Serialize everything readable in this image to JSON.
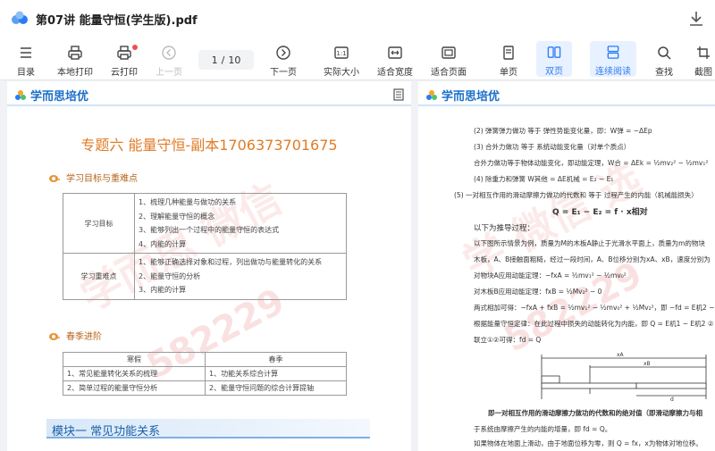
{
  "window": {
    "title": "第07讲 能量守恒(学生版).pdf"
  },
  "toolbar": {
    "items": [
      {
        "label": "目录",
        "icon": "list-icon"
      },
      {
        "label": "本地打印",
        "icon": "printer-icon"
      },
      {
        "label": "云打印",
        "icon": "cloud-printer-icon"
      },
      {
        "label": "上一页",
        "icon": "prev-page-icon"
      },
      {
        "label": "下一页",
        "icon": "next-page-icon"
      },
      {
        "label": "实际大小",
        "icon": "actual-size-icon"
      },
      {
        "label": "适合宽度",
        "icon": "fit-width-icon"
      },
      {
        "label": "适合页面",
        "icon": "fit-page-icon"
      },
      {
        "label": "单页",
        "icon": "single-page-icon"
      },
      {
        "label": "双页",
        "icon": "double-page-icon"
      },
      {
        "label": "连续阅读",
        "icon": "continuous-read-icon"
      },
      {
        "label": "查找",
        "icon": "search-icon"
      },
      {
        "label": "截图",
        "icon": "screenshot-icon"
      }
    ],
    "page_current": "1",
    "page_separator": "/",
    "page_total": "10",
    "accent": "#2a7cf6"
  },
  "left_page": {
    "brand": "学而思培优",
    "watermark": "学而思 微信",
    "watermark_num": "582229",
    "topic_title": "专题六 能量守恒-副本1706373701675",
    "section1": "学习目标与重难点",
    "goals": {
      "label": "学习目标",
      "items": [
        "1、梳理几种能量与做功的关系",
        "2、理解能量守恒的概念",
        "3、能够列出一个过程中的能量守恒的表达式",
        "4、内能的计算"
      ]
    },
    "key_points": {
      "label": "学习重难点",
      "items": [
        "1、能够正确选择对象和过程，列出做功与能量转化的关系",
        "2、能量守恒的分析",
        "3、内能的计算"
      ]
    },
    "section2": "春季进阶",
    "table2": {
      "headers": [
        "寒假",
        "春季"
      ],
      "rows": [
        [
          "1、常见能量转化关系的梳理",
          "1、功能关系综合计算"
        ],
        [
          "2、简单过程的能量守恒分析",
          "2、能量守恒问题的综合计算提轴"
        ]
      ]
    },
    "module_title": "模块一 常见功能关系"
  },
  "right_page": {
    "brand": "学而思培优",
    "watermark": "学 微信 选",
    "watermark_num": "582229",
    "lines": [
      "(2) 弹簧弹力做功 等于 弹性势能变化量，即：W弹 = −ΔEp",
      "(3) 合外力做功 等于 系统动能变化量（对单个质点）",
      "合外力做功等于物体动能变化，即动能定理，W合 = ΔEk = ½mv₂² − ½mv₁²",
      "(4) 除重力和弹簧 W其他 = ΔE机械 = E₂ − E₁",
      "(5) 一对相互作用的滑动摩擦力做功的代数和 等于 过程产生的内能（机械能损失）",
      "以下为推导过程：",
      "以下图所示情景为例，质量为M的木板A静止于光滑水平面上，质量为m的物块",
      "木板，A、B接触面粗糙，经过一段时间，A、B位移分别为xA、xB，速度分别为",
      "对物块A应用动能定理：−fxA = ½mv₁² − ½mv₀²",
      "对木板B应用动能定理：fxB = ½Mv₂² − 0",
      "两式相加可得：−fxA + fxB = ½mv₁² − ½mv₀² + ½Mv₂²，即 −fd = E机2 − E机1 ①",
      "根据能量守恒定律：在此过程中损失的动能转化为内能，即 Q = E机1 − E机2 ②",
      "联立①②可得：fd = Q",
      "即一对相互作用的滑动摩擦力做功的代数和的绝对值（即滑动摩擦力与相",
      "于系统由摩擦产生的内能的增量，即 fd = Q。",
      "如果物体在地面上滑动，由于地面位移为零，则 Q = fx，x为物体对地位移。"
    ],
    "formula": "Q = E₁ − E₂ = f · x相对",
    "diagram": {
      "label_top": "xA",
      "label_mid": "xB",
      "label_bottom": "d"
    }
  }
}
